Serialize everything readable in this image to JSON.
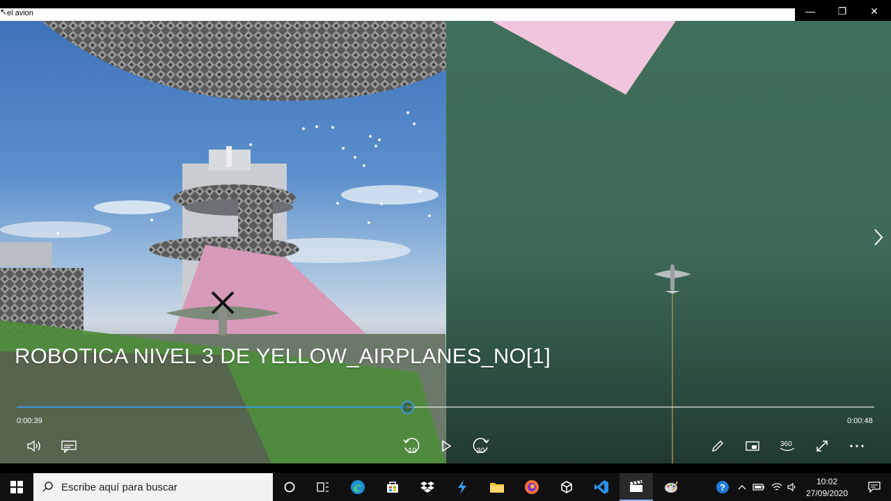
{
  "window": {
    "title": "el avion",
    "minimize_glyph": "—",
    "restore_glyph": "❐",
    "close_glyph": "✕"
  },
  "video": {
    "caption": "ROBOTICA NIVEL 3 DE YELLOW_AIRPLANES_NO[1]",
    "current_time": "0:00:39",
    "total_time": "0:00:48",
    "progress": 0.455,
    "skip_back_label": "10",
    "skip_forward_label": "30",
    "view_360_label": "360"
  },
  "taskbar": {
    "search_placeholder": "Escribe aquí para buscar",
    "clock_time": "10:02",
    "clock_date": "27/09/2020"
  },
  "colors": {
    "accent": "#3a9be0",
    "taskbar": "#101010"
  }
}
